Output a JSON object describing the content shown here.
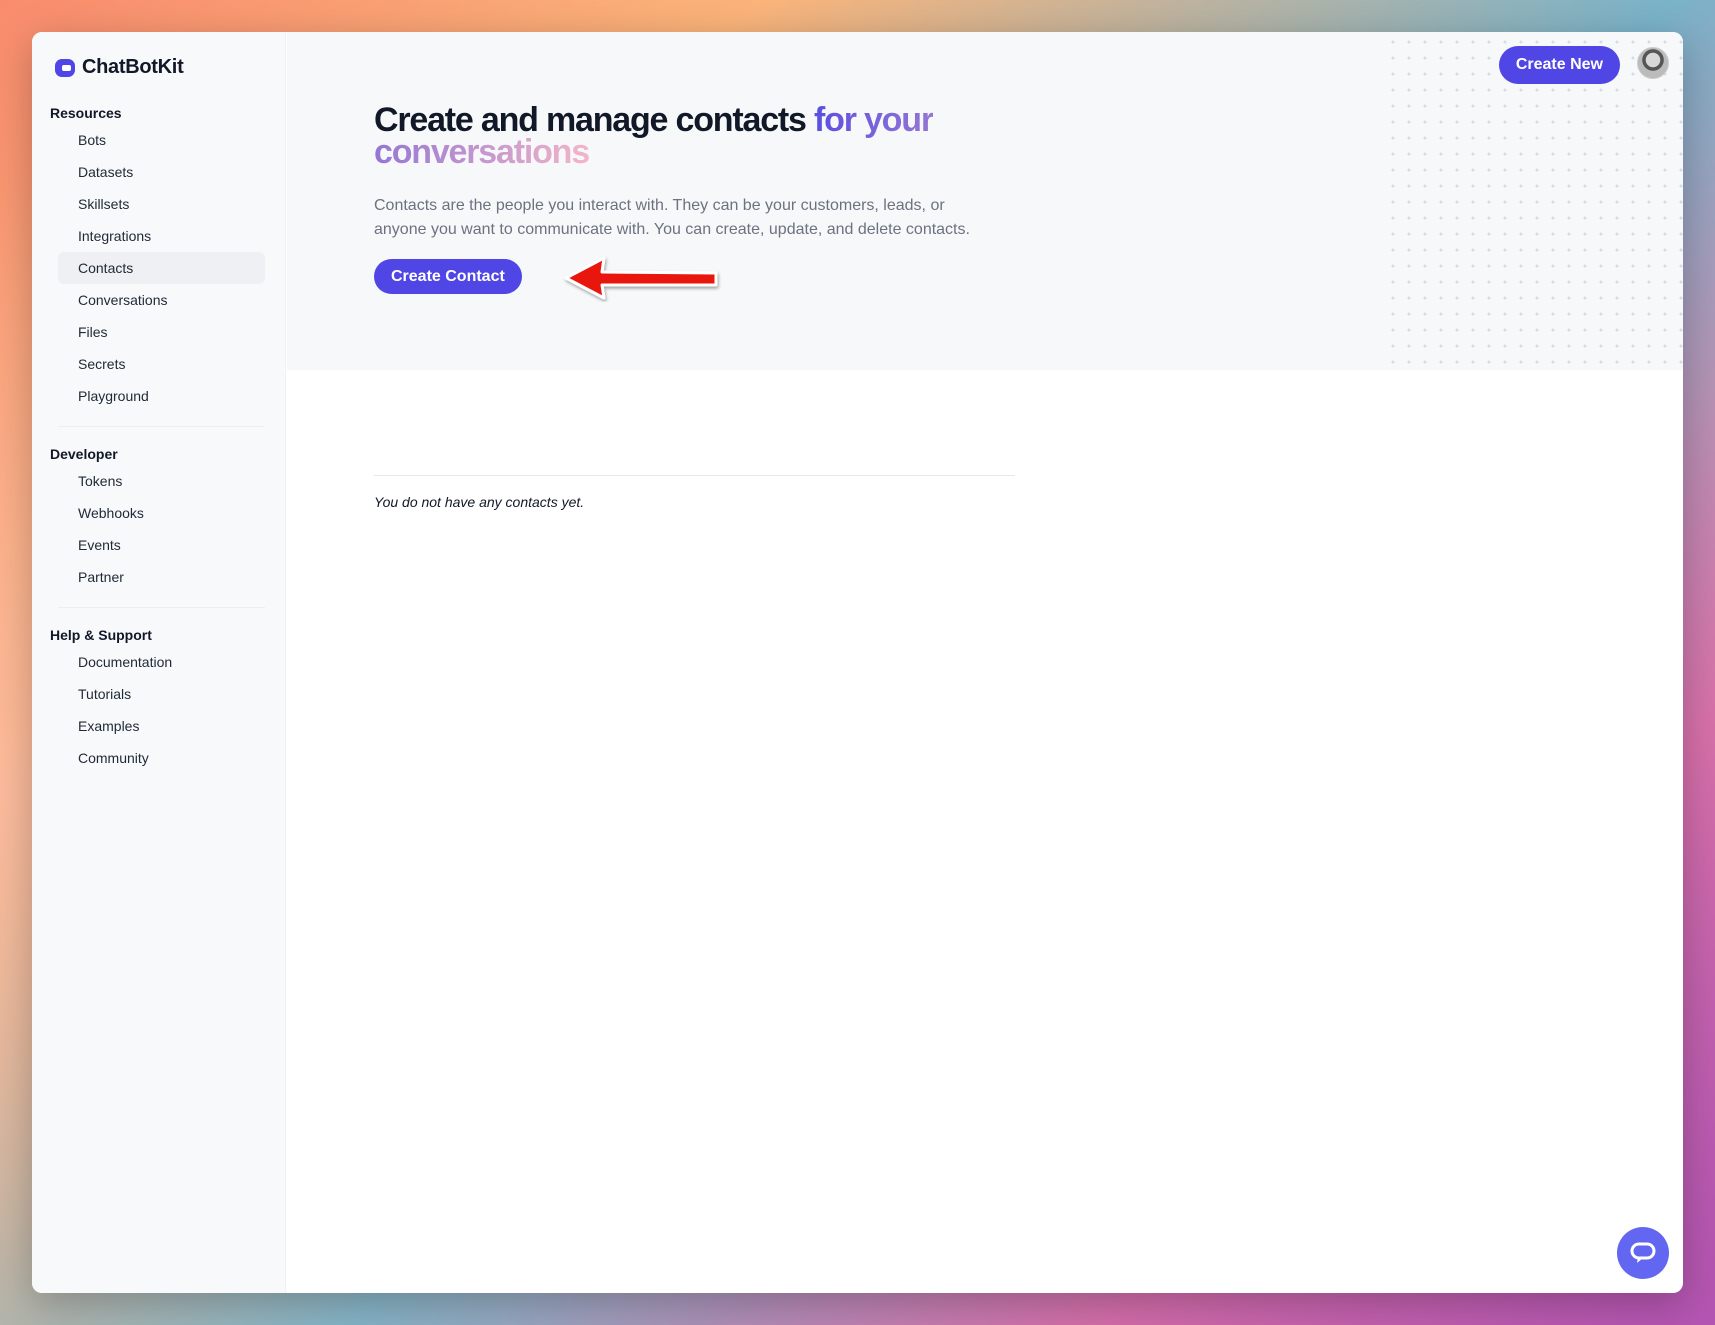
{
  "brand": {
    "name": "ChatBotKit",
    "accent": "#4f46e5"
  },
  "sidebar": {
    "groups": [
      {
        "heading": "Resources",
        "items": [
          {
            "label": "Bots"
          },
          {
            "label": "Datasets"
          },
          {
            "label": "Skillsets"
          },
          {
            "label": "Integrations"
          },
          {
            "label": "Contacts",
            "active": true
          },
          {
            "label": "Conversations"
          },
          {
            "label": "Files"
          },
          {
            "label": "Secrets"
          },
          {
            "label": "Playground"
          }
        ]
      },
      {
        "heading": "Developer",
        "items": [
          {
            "label": "Tokens"
          },
          {
            "label": "Webhooks"
          },
          {
            "label": "Events"
          },
          {
            "label": "Partner"
          }
        ]
      },
      {
        "heading": "Help & Support",
        "items": [
          {
            "label": "Documentation"
          },
          {
            "label": "Tutorials"
          },
          {
            "label": "Examples"
          },
          {
            "label": "Community"
          }
        ]
      }
    ]
  },
  "header": {
    "create_new_label": "Create New",
    "avatar_icon": "user-avatar"
  },
  "hero": {
    "title_main": "Create and manage contacts",
    "title_accent": "for your conversations",
    "description": "Contacts are the people you interact with. They can be your customers, leads, or anyone you want to communicate with. You can create, update, and delete contacts.",
    "create_contact_label": "Create Contact",
    "annotation_icon": "red-arrow-left-icon"
  },
  "contacts": {
    "empty_message": "You do not have any contacts yet."
  },
  "chat_widget": {
    "icon": "chat-bubble-icon"
  }
}
